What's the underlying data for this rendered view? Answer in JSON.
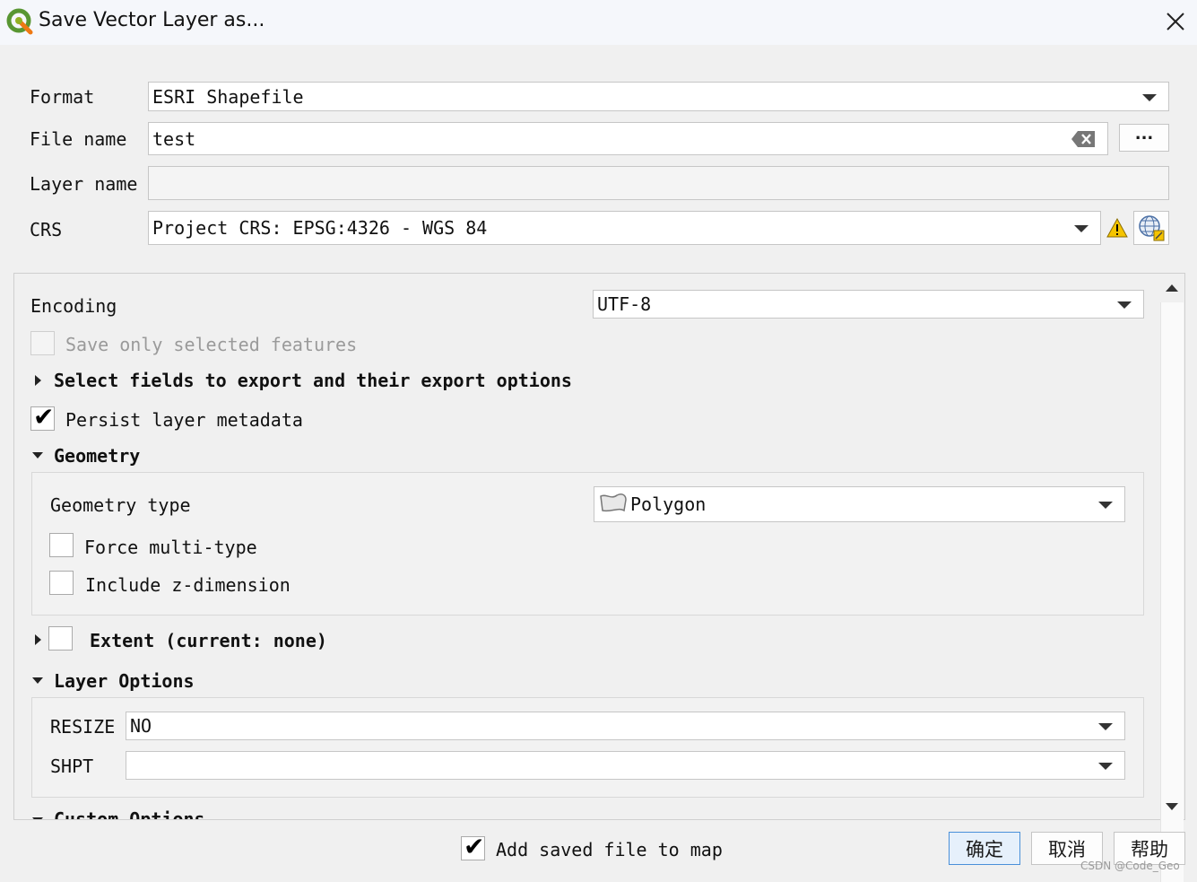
{
  "window": {
    "title": "Save Vector Layer as...",
    "icon": "qgis-logo-icon",
    "close_icon": "close-icon"
  },
  "form": {
    "format_label": "Format",
    "format_value": "ESRI Shapefile",
    "filename_label": "File name",
    "filename_value": "test",
    "browse_label": "...",
    "layername_label": "Layer name",
    "layername_value": "",
    "crs_label": "CRS",
    "crs_value": "Project CRS: EPSG:4326 - WGS 84"
  },
  "options": {
    "encoding_label": "Encoding",
    "encoding_value": "UTF-8",
    "save_selected_label": "Save only selected features",
    "save_selected_checked": false,
    "select_fields_label": "Select fields to export and their export options",
    "persist_metadata_label": "Persist layer metadata",
    "persist_metadata_checked": true,
    "geometry_header": "Geometry",
    "geometry_type_label": "Geometry type",
    "geometry_type_value": "Polygon",
    "force_multi_label": "Force multi-type",
    "include_z_label": "Include z-dimension",
    "extent_label": "Extent (current: none)",
    "layer_options_header": "Layer Options",
    "resize_label": "RESIZE",
    "resize_value": "NO",
    "shpt_label": "SHPT",
    "shpt_value": "",
    "custom_options_header": "Custom Options"
  },
  "footer": {
    "add_to_map_label": "Add saved file to map",
    "add_to_map_checked": true,
    "ok_label": "确定",
    "cancel_label": "取消",
    "help_label": "帮助",
    "watermark": "CSDN @Code_Geo"
  },
  "colors": {
    "ok_border": "#4a90d9",
    "warning": "#f5c400"
  }
}
